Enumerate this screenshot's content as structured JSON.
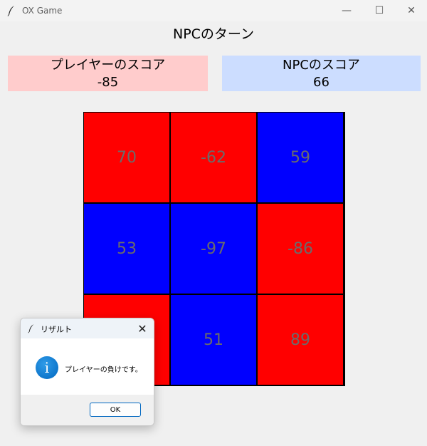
{
  "window": {
    "title": "OX Game",
    "minimize": "—",
    "maximize": "☐",
    "close": "✕"
  },
  "turn_label": "NPCのターン",
  "scores": {
    "player": {
      "label": "プレイヤーのスコア",
      "value": "-85",
      "color": "#ffcccc"
    },
    "npc": {
      "label": "NPCのスコア",
      "value": "66",
      "color": "#ccddff"
    }
  },
  "board": {
    "cells": [
      {
        "value": "70",
        "owner": "red"
      },
      {
        "value": "-62",
        "owner": "red"
      },
      {
        "value": "59",
        "owner": "blue"
      },
      {
        "value": "53",
        "owner": "blue"
      },
      {
        "value": "-97",
        "owner": "blue"
      },
      {
        "value": "-86",
        "owner": "red"
      },
      {
        "value": "",
        "owner": "red"
      },
      {
        "value": "51",
        "owner": "blue"
      },
      {
        "value": "89",
        "owner": "red"
      }
    ],
    "colors": {
      "red": "#ff0000",
      "blue": "#0000ff",
      "text": "#6b6b6b"
    }
  },
  "dialog": {
    "title": "リザルト",
    "message": "プレイヤーの負けです。",
    "ok_label": "OK",
    "close": "✕",
    "info_glyph": "i"
  }
}
